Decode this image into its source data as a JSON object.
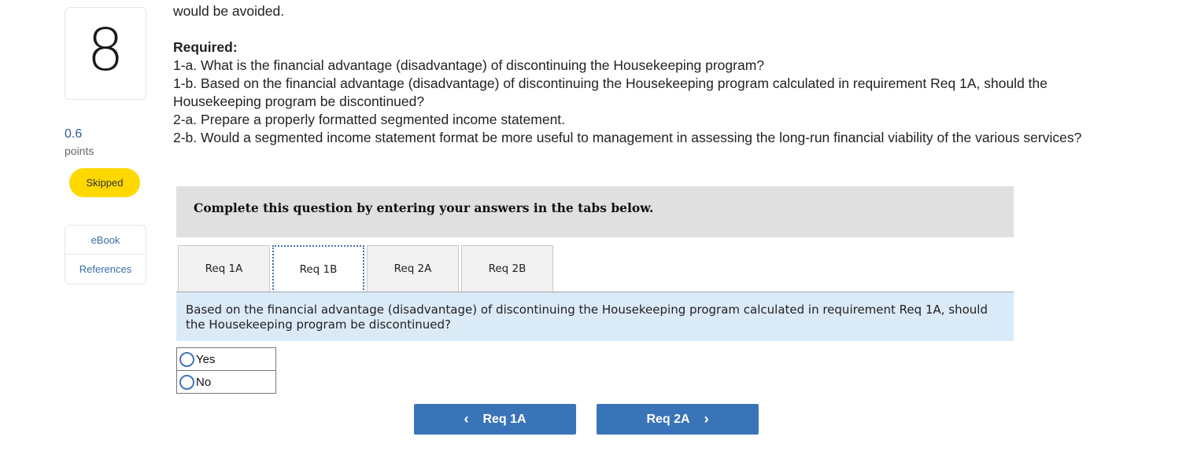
{
  "question": {
    "number": "8",
    "points_value": "0.6",
    "points_label": "points",
    "status": "Skipped"
  },
  "resources": [
    {
      "label": "eBook"
    },
    {
      "label": "References"
    }
  ],
  "prompt": {
    "cut_line": "would be avoided.",
    "required_heading": "Required:",
    "requirements": [
      "1-a. What is the financial advantage (disadvantage) of discontinuing the Housekeeping program?",
      "1-b. Based on the financial advantage (disadvantage) of discontinuing the Housekeeping program calculated in requirement Req 1A, should the Housekeeping program be discontinued?",
      "2-a. Prepare a properly formatted segmented income statement.",
      "2-b. Would a segmented income statement format be more useful to management in assessing the long-run financial viability of the various services?"
    ]
  },
  "instruction": "Complete this question by entering your answers in the tabs below.",
  "tabs": [
    {
      "label": "Req 1A",
      "active": false
    },
    {
      "label": "Req 1B",
      "active": true
    },
    {
      "label": "Req 2A",
      "active": false
    },
    {
      "label": "Req 2B",
      "active": false
    }
  ],
  "active_question": "Based on the financial advantage (disadvantage) of discontinuing the Housekeeping program calculated in requirement Req 1A, should the Housekeeping program be discontinued?",
  "options": [
    {
      "label": "Yes",
      "selected": false
    },
    {
      "label": "No",
      "selected": false
    }
  ],
  "nav": {
    "prev_label": "Req 1A",
    "prev_icon": "chevron-left-icon",
    "next_label": "Req 2A",
    "next_icon": "chevron-right-icon"
  },
  "colors": {
    "skipped_badge": "#ffd800",
    "nav_button": "#3a74b8",
    "banner_bg": "#dbeaf7",
    "instruction_bg": "#e0e0e0",
    "radio_ring": "#3f75b8"
  }
}
